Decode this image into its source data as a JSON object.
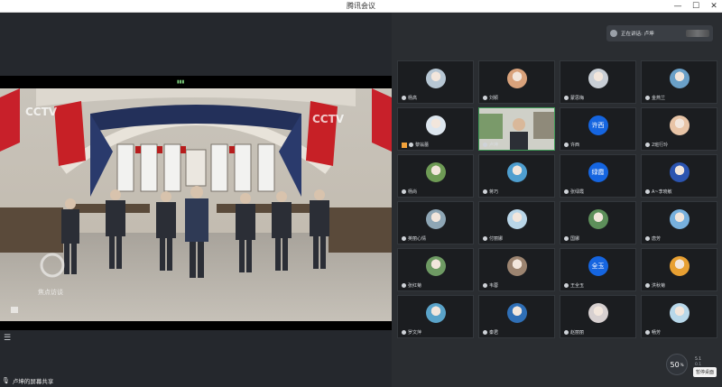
{
  "window": {
    "title": "腾讯会议",
    "controls": [
      "—",
      "☐",
      "✕"
    ]
  },
  "left": {
    "share_label": "卢坤的屏幕共享",
    "video_overlay": {
      "watermark": "CCTV",
      "bottom_logo": "焦点访谈"
    }
  },
  "right": {
    "speaking": "正在讲话: 卢坤",
    "participants": [
      {
        "name": "杨高",
        "avatar": "photo",
        "color": "#b7c7d4"
      },
      {
        "name": "刘颖",
        "avatar": "photo",
        "color": "#d9a27b"
      },
      {
        "name": "蒙思梅",
        "avatar": "photo",
        "color": "#c9cfd6"
      },
      {
        "name": "金燕兰",
        "avatar": "photo",
        "color": "#6aa0c8"
      },
      {
        "name": "黎翁蕾",
        "avatar": "photo",
        "color": "#dde6ee",
        "warn": true
      },
      {
        "name": "卢坤",
        "avatar": "video",
        "color": "#cfd0c8",
        "active": true
      },
      {
        "name": "许西",
        "avatar": "text",
        "text": "许西",
        "color": "#1565e0"
      },
      {
        "name": "2班行玲",
        "avatar": "photo",
        "color": "#e8c4a6"
      },
      {
        "name": "杨尚",
        "avatar": "photo",
        "color": "#6e9b55"
      },
      {
        "name": "蒋巧",
        "avatar": "photo",
        "color": "#4e9ecf"
      },
      {
        "name": "张绿霞",
        "avatar": "text",
        "text": "绿霞",
        "color": "#1565e0"
      },
      {
        "name": "A~李晓敏",
        "avatar": "photo",
        "color": "#2b54b0"
      },
      {
        "name": "英丽心情",
        "avatar": "photo",
        "color": "#8ea6b5"
      },
      {
        "name": "付丽娜",
        "avatar": "photo",
        "color": "#b9d6e8"
      },
      {
        "name": "国娜",
        "avatar": "photo",
        "color": "#5d8f5a"
      },
      {
        "name": "唐芳",
        "avatar": "photo",
        "color": "#77b0dd"
      },
      {
        "name": "张红菊",
        "avatar": "photo",
        "color": "#6e9a63"
      },
      {
        "name": "韦蓉",
        "avatar": "photo",
        "color": "#9c8470"
      },
      {
        "name": "王全玉",
        "avatar": "text",
        "text": "全玉",
        "color": "#1565e0"
      },
      {
        "name": "洪秋菊",
        "avatar": "photo",
        "color": "#e8a032"
      },
      {
        "name": "罗文萍",
        "avatar": "photo",
        "color": "#5aa3c9"
      },
      {
        "name": "秦君",
        "avatar": "photo",
        "color": "#2f6fb6"
      },
      {
        "name": "赵丽丽",
        "avatar": "photo",
        "color": "#d7d0d0"
      },
      {
        "name": "畅芳",
        "avatar": "photo",
        "color": "#b8d8ea"
      }
    ],
    "zoom": {
      "value": "50",
      "unit": "%"
    },
    "net_speed": "5.1",
    "net_speed2": "0.1",
    "tooltip": "暂停桌面"
  }
}
